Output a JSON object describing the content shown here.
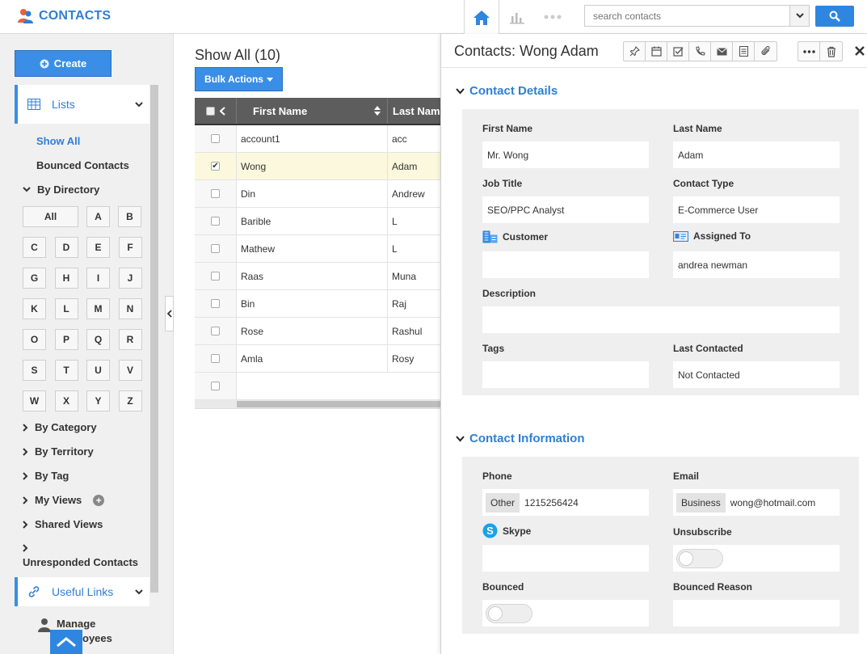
{
  "app": {
    "title": "CONTACTS"
  },
  "search": {
    "placeholder": "search contacts"
  },
  "sidebar": {
    "create_label": "Create",
    "lists_label": "Lists",
    "show_all": "Show All",
    "bounced": "Bounced Contacts",
    "by_directory": "By Directory",
    "alpha_all": "All",
    "letters": [
      "A",
      "B",
      "C",
      "D",
      "E",
      "F",
      "G",
      "H",
      "I",
      "J",
      "K",
      "L",
      "M",
      "N",
      "O",
      "P",
      "Q",
      "R",
      "S",
      "T",
      "U",
      "V",
      "W",
      "X",
      "Y",
      "Z"
    ],
    "by_category": "By Category",
    "by_territory": "By Territory",
    "by_tag": "By Tag",
    "my_views": "My Views",
    "shared_views": "Shared Views",
    "unresponded": "Unresponded Contacts",
    "useful_links": "Useful Links",
    "manage_employees_1": "Manage",
    "manage_employees_2": "oyees"
  },
  "main": {
    "title": "Show All (10)",
    "bulk_actions": "Bulk Actions",
    "columns": {
      "first": "First Name",
      "last": "Last Name"
    },
    "rows": [
      {
        "first": "account1",
        "last": "acc",
        "checked": false
      },
      {
        "first": "Wong",
        "last": "Adam",
        "checked": true
      },
      {
        "first": "Din",
        "last": "Andrew",
        "checked": false
      },
      {
        "first": "Barible",
        "last": "L",
        "checked": false
      },
      {
        "first": "Mathew",
        "last": "L",
        "checked": false
      },
      {
        "first": "Raas",
        "last": "Muna",
        "checked": false
      },
      {
        "first": "Bin",
        "last": "Raj",
        "checked": false
      },
      {
        "first": "Rose",
        "last": "Rashul",
        "checked": false
      },
      {
        "first": "Amla",
        "last": "Rosy",
        "checked": false
      }
    ]
  },
  "panel": {
    "title": "Contacts: Wong Adam",
    "contact_details": {
      "title": "Contact Details",
      "first_name_label": "First Name",
      "first_name": "Mr. Wong",
      "last_name_label": "Last Name",
      "last_name": "Adam",
      "job_title_label": "Job Title",
      "job_title": "SEO/PPC Analyst",
      "contact_type_label": "Contact Type",
      "contact_type": "E-Commerce User",
      "customer_label": "Customer",
      "customer": "",
      "assigned_to_label": "Assigned To",
      "assigned_to": "andrea newman",
      "description_label": "Description",
      "description": "",
      "tags_label": "Tags",
      "tags": "",
      "last_contacted_label": "Last Contacted",
      "last_contacted": "Not Contacted"
    },
    "contact_info": {
      "title": "Contact Information",
      "phone_label": "Phone",
      "phone_type": "Other",
      "phone": "1215256424",
      "email_label": "Email",
      "email_type": "Business",
      "email": "wong@hotmail.com",
      "skype_label": "Skype",
      "skype": "",
      "unsubscribe_label": "Unsubscribe",
      "unsubscribe": false,
      "bounced_label": "Bounced",
      "bounced": false,
      "bounced_reason_label": "Bounced Reason",
      "bounced_reason": ""
    }
  },
  "colors": {
    "accent": "#2f7fd6",
    "button": "#3a8ee6",
    "header_dark": "#5d5d5d",
    "selected_row": "#fbf8dd"
  }
}
